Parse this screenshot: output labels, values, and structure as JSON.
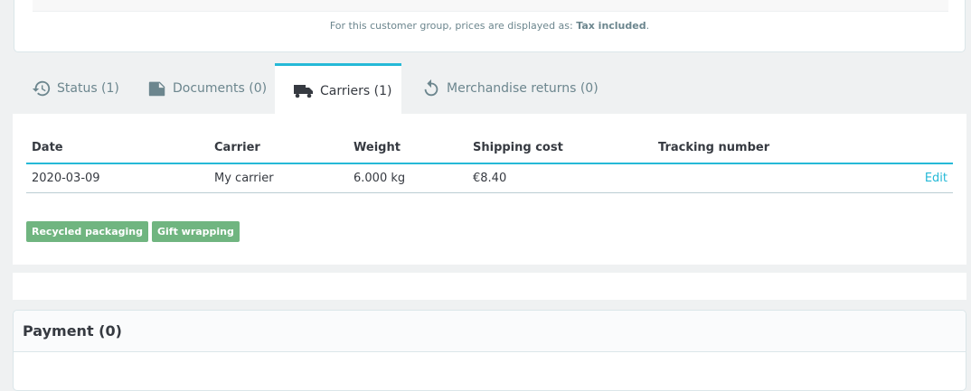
{
  "prices_note": {
    "prefix": "For this customer group, prices are displayed as: ",
    "value": "Tax included",
    "suffix": "."
  },
  "tabs": [
    {
      "label": "Status (1)",
      "icon": "history-icon"
    },
    {
      "label": "Documents (0)",
      "icon": "document-icon"
    },
    {
      "label": "Carriers (1)",
      "icon": "truck-icon",
      "active": true
    },
    {
      "label": "Merchandise returns (0)",
      "icon": "undo-icon"
    }
  ],
  "carriers": {
    "columns": [
      "Date",
      "Carrier",
      "Weight",
      "Shipping cost",
      "Tracking number"
    ],
    "rows": [
      {
        "date": "2020-03-09",
        "carrier": "My carrier",
        "weight": "6.000 kg",
        "shipping_cost": "€8.40",
        "tracking": "",
        "action": "Edit"
      }
    ],
    "badges": [
      "Recycled packaging",
      "Gift wrapping"
    ]
  },
  "payment": {
    "title": "Payment (0)"
  },
  "colors": {
    "accent": "#25b9d7",
    "badge": "#70b580"
  }
}
